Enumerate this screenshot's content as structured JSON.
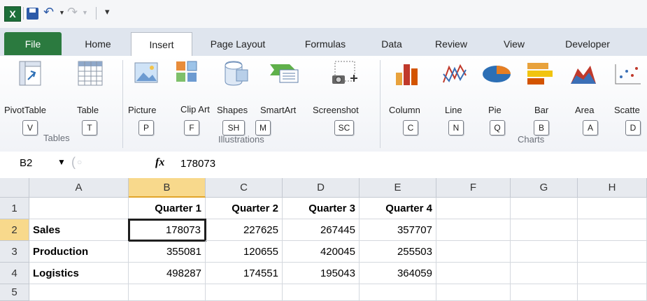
{
  "ribbon_tabs": [
    "File",
    "Home",
    "Insert",
    "Page Layout",
    "Formulas",
    "Data",
    "Review",
    "View",
    "Developer"
  ],
  "ribbon": {
    "tables": {
      "pivottable": "PivotTable",
      "table": "Table",
      "group": "Tables",
      "key_pivot": "V",
      "key_table": "T"
    },
    "illustrations": {
      "picture": "Picture",
      "clipart": "Clip Art",
      "shapes": "Shapes",
      "smartart": "SmartArt",
      "screenshot": "Screenshot",
      "group": "Illustrations",
      "key_picture": "P",
      "key_clip": "F",
      "key_shapes": "SH",
      "key_smartart": "M",
      "key_screenshot": "SC"
    },
    "charts": {
      "column": "Column",
      "line": "Line",
      "pie": "Pie",
      "bar": "Bar",
      "area": "Area",
      "scatter": "Scatte",
      "group": "Charts",
      "key_column": "C",
      "key_line": "N",
      "key_pie": "Q",
      "key_bar": "B",
      "key_area": "A",
      "key_scatter": "D"
    }
  },
  "formula_bar": {
    "name_box": "B2",
    "fx": "fx",
    "value": "178073"
  },
  "columns": [
    "A",
    "B",
    "C",
    "D",
    "E",
    "F",
    "G",
    "H"
  ],
  "rows": [
    "1",
    "2",
    "3",
    "4",
    "5"
  ],
  "header_row": [
    "",
    "Quarter 1",
    "Quarter 2",
    "Quarter 3",
    "Quarter 4"
  ],
  "data_rows": [
    {
      "label": "Sales",
      "values": [
        "178073",
        "227625",
        "267445",
        "357707"
      ]
    },
    {
      "label": "Production",
      "values": [
        "355081",
        "120655",
        "420045",
        "255503"
      ]
    },
    {
      "label": "Logistics",
      "values": [
        "498287",
        "174551",
        "195043",
        "364059"
      ]
    }
  ],
  "active_cell": "B2",
  "colors": {
    "file_tab": "#2b7a3f",
    "selection_header": "#f8d98c"
  }
}
